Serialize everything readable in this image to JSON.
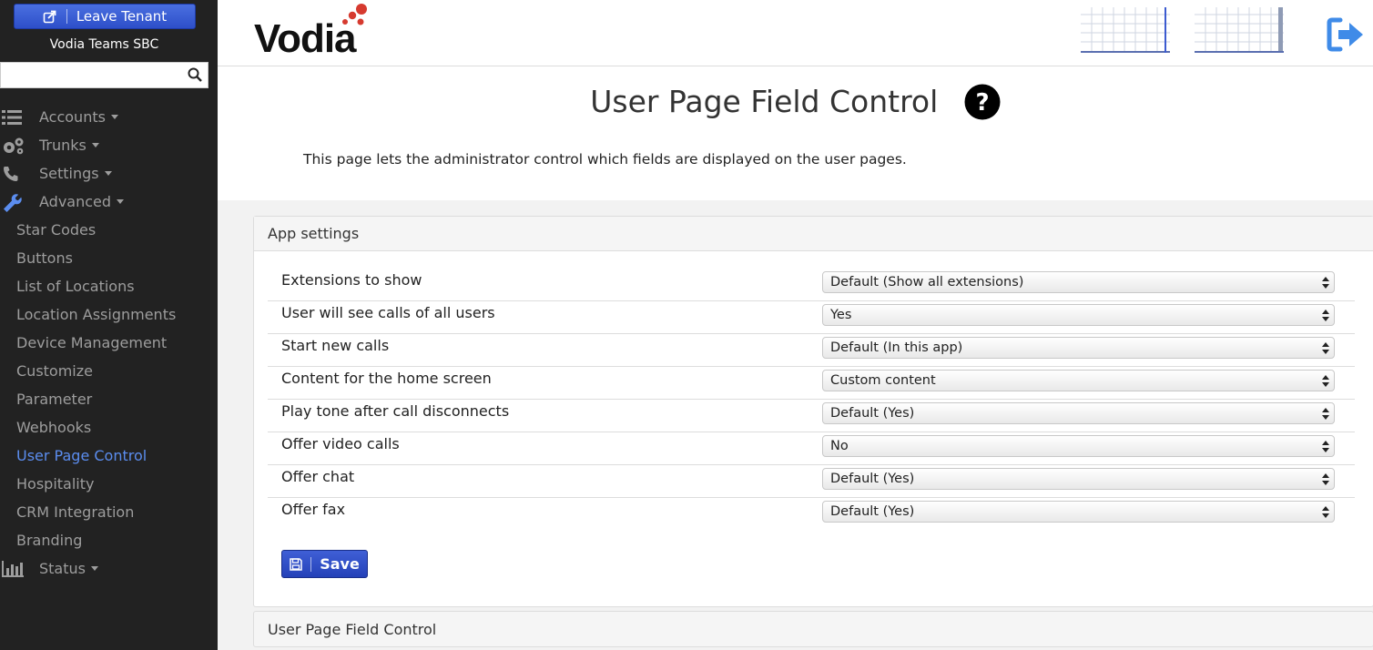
{
  "sidebar": {
    "leave_tenant_label": "Leave Tenant",
    "tenant_name": "Vodia Teams SBC",
    "search": {
      "value": "",
      "placeholder": ""
    },
    "nav": [
      {
        "label": "Accounts",
        "icon": "list-icon"
      },
      {
        "label": "Trunks",
        "icon": "gears-icon"
      },
      {
        "label": "Settings",
        "icon": "phone-icon"
      },
      {
        "label": "Advanced",
        "icon": "wrench-icon"
      }
    ],
    "sub_items": [
      {
        "label": "Star Codes"
      },
      {
        "label": "Buttons"
      },
      {
        "label": "List of Locations"
      },
      {
        "label": "Location Assignments"
      },
      {
        "label": "Device Management"
      },
      {
        "label": "Customize"
      },
      {
        "label": "Parameter"
      },
      {
        "label": "Webhooks"
      },
      {
        "label": "User Page Control",
        "active": true
      },
      {
        "label": "Hospitality"
      },
      {
        "label": "CRM Integration"
      },
      {
        "label": "Branding"
      }
    ],
    "status": {
      "label": "Status",
      "icon": "bar-chart-icon"
    },
    "active_color": "#5b8def",
    "background": "#222222"
  },
  "header": {
    "logo_text": "Vodia",
    "icons": [
      "grid-layout-icon",
      "grid-layout-icon",
      "logout-icon"
    ]
  },
  "main": {
    "title": "User Page Field Control",
    "description": "This page lets the administrator control which fields are displayed on the user pages.",
    "panel": {
      "title": "App settings",
      "rows": [
        {
          "label": "Extensions to show",
          "value": "Default (Show all extensions)"
        },
        {
          "label": "User will see calls of all users",
          "value": "Yes"
        },
        {
          "label": "Start new calls",
          "value": "Default (In this app)"
        },
        {
          "label": "Content for the home screen",
          "value": "Custom content"
        },
        {
          "label": "Play tone after call disconnects",
          "value": "Default (Yes)"
        },
        {
          "label": "Offer video calls",
          "value": "No"
        },
        {
          "label": "Offer chat",
          "value": "Default (Yes)"
        },
        {
          "label": "Offer fax",
          "value": "Default (Yes)"
        }
      ],
      "save_label": "Save"
    },
    "panel2_title": "User Page Field Control"
  },
  "colors": {
    "brand_blue": "#2d4fc9",
    "accent_link": "#5b8def",
    "logo_red": "#d63a2f"
  }
}
